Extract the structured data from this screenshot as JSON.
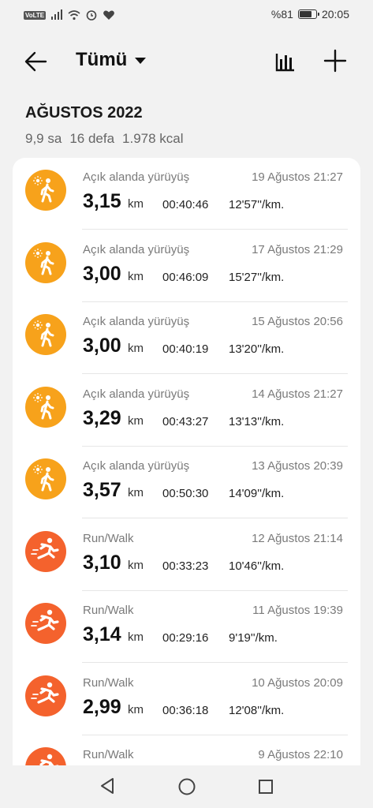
{
  "status_bar": {
    "volte": "VoLTE",
    "battery_text": "%81",
    "battery_level": 0.81,
    "time": "20:05"
  },
  "header": {
    "title": "Tümü"
  },
  "month": {
    "label": "AĞUSTOS 2022",
    "summary": [
      "9,9 sa",
      "16 defa",
      "1.978 kcal"
    ]
  },
  "colors": {
    "walk": "#f7a21b",
    "run": "#f4622d"
  },
  "activities": [
    {
      "type": "Açık alanda yürüyüş",
      "kind": "walk",
      "date": "19 Ağustos 21:27",
      "distance": "3,15",
      "unit": "km",
      "duration": "00:40:46",
      "pace": "12'57''/km."
    },
    {
      "type": "Açık alanda yürüyüş",
      "kind": "walk",
      "date": "17 Ağustos 21:29",
      "distance": "3,00",
      "unit": "km",
      "duration": "00:46:09",
      "pace": "15'27''/km."
    },
    {
      "type": "Açık alanda yürüyüş",
      "kind": "walk",
      "date": "15 Ağustos 20:56",
      "distance": "3,00",
      "unit": "km",
      "duration": "00:40:19",
      "pace": "13'20''/km."
    },
    {
      "type": "Açık alanda yürüyüş",
      "kind": "walk",
      "date": "14 Ağustos 21:27",
      "distance": "3,29",
      "unit": "km",
      "duration": "00:43:27",
      "pace": "13'13''/km."
    },
    {
      "type": "Açık alanda yürüyüş",
      "kind": "walk",
      "date": "13 Ağustos 20:39",
      "distance": "3,57",
      "unit": "km",
      "duration": "00:50:30",
      "pace": "14'09''/km."
    },
    {
      "type": "Run/Walk",
      "kind": "run",
      "date": "12 Ağustos 21:14",
      "distance": "3,10",
      "unit": "km",
      "duration": "00:33:23",
      "pace": "10'46''/km."
    },
    {
      "type": "Run/Walk",
      "kind": "run",
      "date": "11 Ağustos 19:39",
      "distance": "3,14",
      "unit": "km",
      "duration": "00:29:16",
      "pace": "9'19''/km."
    },
    {
      "type": "Run/Walk",
      "kind": "run",
      "date": "10 Ağustos 20:09",
      "distance": "2,99",
      "unit": "km",
      "duration": "00:36:18",
      "pace": "12'08''/km."
    },
    {
      "type": "Run/Walk",
      "kind": "run",
      "date": "9 Ağustos 22:10",
      "distance": "",
      "unit": "",
      "duration": "",
      "pace": ""
    }
  ]
}
